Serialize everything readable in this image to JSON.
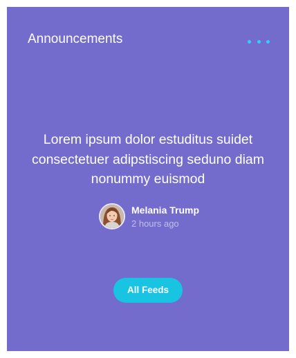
{
  "card": {
    "title": "Announcements",
    "menu_icon": "more-horizontal-icon",
    "accent_color": "#2fd0ff",
    "background_color": "#736ccd"
  },
  "announcement": {
    "text": "Lorem ipsum dolor estuditus suidet consectetuer adipstiscing seduno diam nonummy euismod"
  },
  "author": {
    "name": "Melania Trump",
    "time": "2 hours ago",
    "avatar_icon": "user-avatar"
  },
  "actions": {
    "feeds_label": "All Feeds",
    "feeds_color": "#18c4e2"
  }
}
